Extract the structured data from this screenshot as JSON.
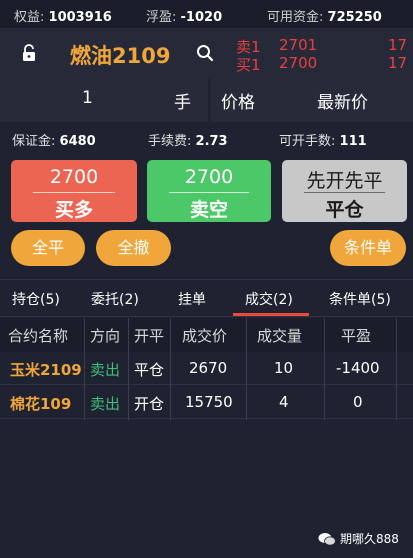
{
  "account": {
    "equity_label": "权益:",
    "equity_value": "1003916",
    "float_pnl_label": "浮盈:",
    "float_pnl_value": "-1020",
    "available_label": "可用资金:",
    "available_value": "725250"
  },
  "header": {
    "contract": "燃油2109",
    "lock_icon": "lock-icon",
    "search_icon": "search-icon",
    "ask_label": "卖1",
    "ask_price": "2701",
    "ask_volume": "17",
    "bid_label": "买1",
    "bid_price": "2700",
    "bid_volume": "17"
  },
  "order": {
    "quantity": "1",
    "unit": "手",
    "price_label": "价格",
    "price_type": "最新价"
  },
  "summary": {
    "margin_label": "保证金:",
    "margin_value": "6480",
    "fee_label": "手续费:",
    "fee_value": "2.73",
    "openable_label": "可开手数:",
    "openable_value": "111"
  },
  "actions": {
    "buy_price": "2700",
    "buy_label": "买多",
    "sell_price": "2700",
    "sell_label": "卖空",
    "close_hint": "先开先平",
    "close_label": "平仓",
    "close_all": "全平",
    "cancel_all": "全撤",
    "conditional": "条件单"
  },
  "tabs": [
    {
      "label": "持仓(5)"
    },
    {
      "label": "委托(2)"
    },
    {
      "label": "挂单"
    },
    {
      "label": "成交(2)"
    },
    {
      "label": "条件单(5)"
    }
  ],
  "table": {
    "headers": [
      "合约名称",
      "方向",
      "开平",
      "成交价",
      "成交量",
      "平盈"
    ],
    "rows": [
      {
        "symbol": "玉米2109",
        "direction": "卖出",
        "offset": "平仓",
        "price": "2670",
        "volume": "10",
        "pnl": "-1400"
      },
      {
        "symbol": "棉花109",
        "direction": "卖出",
        "offset": "开仓",
        "price": "15750",
        "volume": "4",
        "pnl": "0"
      }
    ]
  },
  "watermark": "期哪久888",
  "colors": {
    "accent": "#f0a63a",
    "buy": "#ec6553",
    "sell": "#4cc868",
    "close": "#c8c8c8",
    "quote_red": "#e84040",
    "direction_green": "#3fbf7a"
  }
}
